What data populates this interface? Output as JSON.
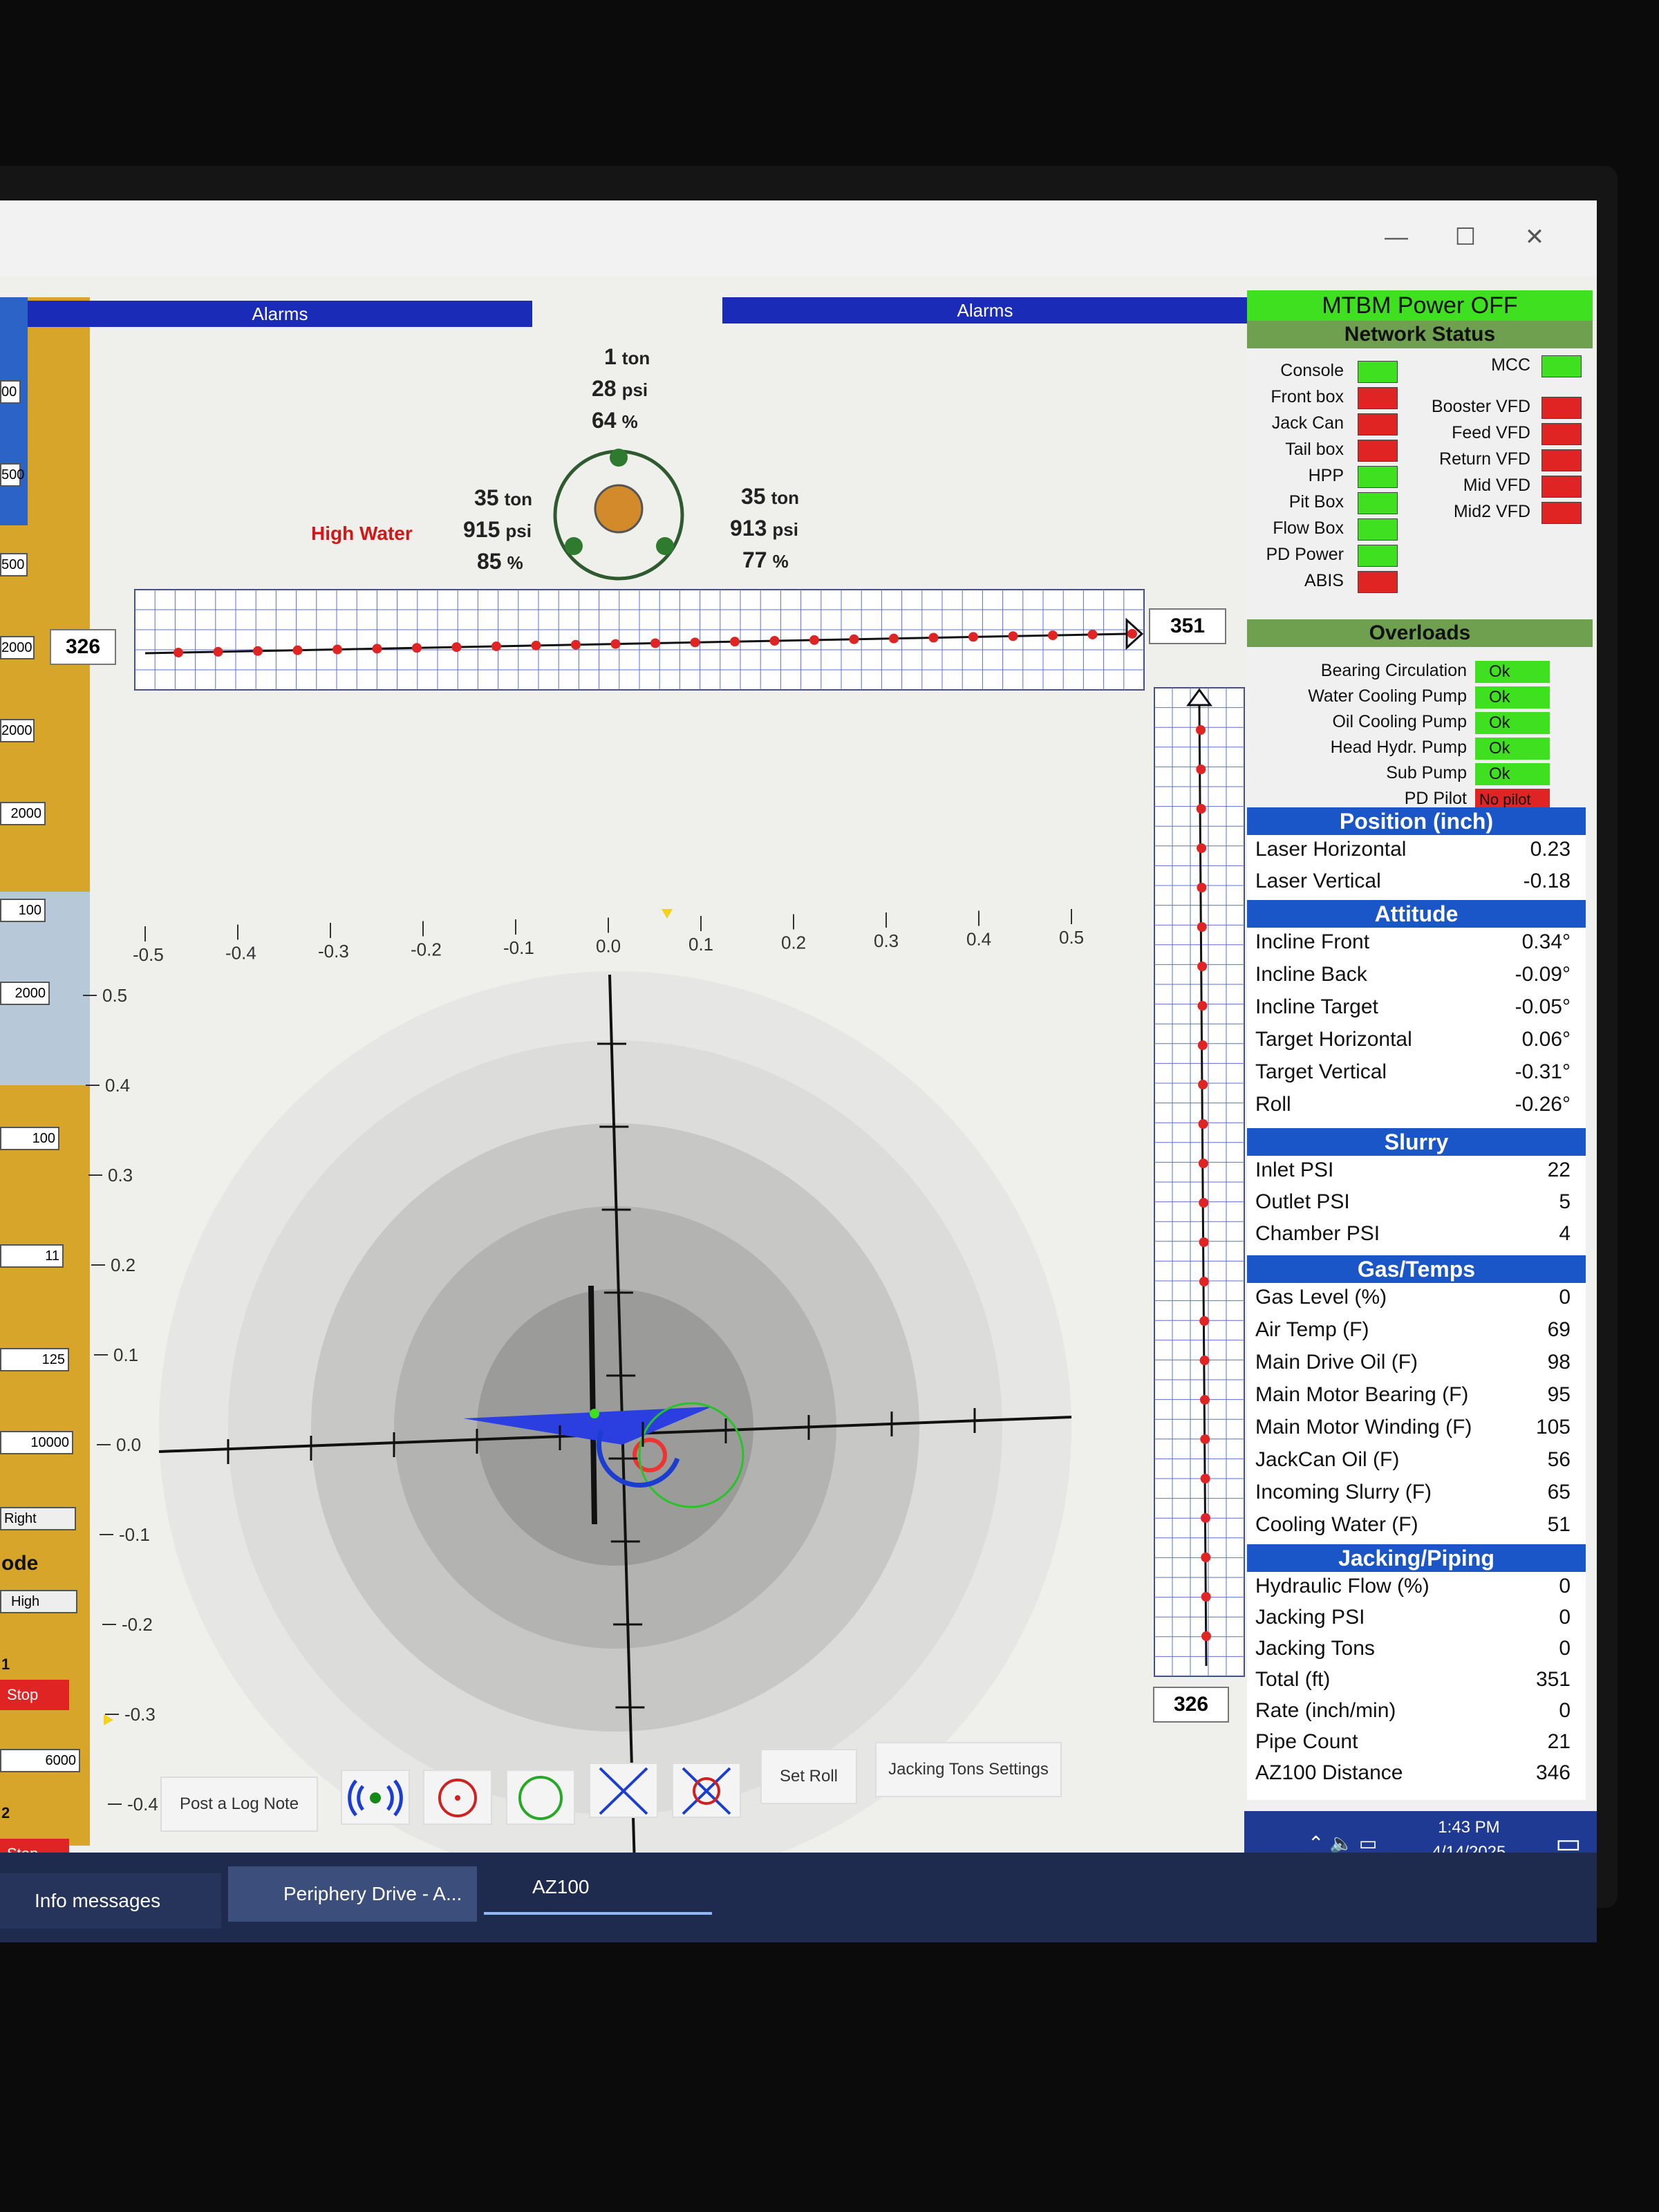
{
  "window": {
    "minimize": "—",
    "maximize": "☐",
    "close": "✕"
  },
  "alarms": {
    "left_label": "Alarms",
    "right_label": "Alarms"
  },
  "left_strip": {
    "values": [
      "00",
      "500",
      "500",
      "2000",
      "2000",
      "2000",
      "100",
      "2000",
      "100",
      "11",
      "125",
      "10000",
      "6000"
    ],
    "right_label": "Right",
    "mode_label": "ode",
    "mode_value": "High",
    "marker1": "1",
    "marker2": "2",
    "stop1": "Stop",
    "stop2": "Stop"
  },
  "gauge": {
    "top": {
      "tons": "1",
      "tons_unit": "ton",
      "psi": "28",
      "psi_unit": "psi",
      "pct": "64",
      "pct_unit": "%"
    },
    "left": {
      "tons": "35",
      "tons_unit": "ton",
      "psi": "915",
      "psi_unit": "psi",
      "pct": "85",
      "pct_unit": "%"
    },
    "right": {
      "tons": "35",
      "tons_unit": "ton",
      "psi": "913",
      "psi_unit": "psi",
      "pct": "77",
      "pct_unit": "%"
    },
    "alert": "High Water"
  },
  "horizontal_bar": {
    "left_value": "326",
    "right_value": "351"
  },
  "vertical_bar": {
    "bottom_value": "326"
  },
  "target": {
    "x_ticks": [
      "-0.5",
      "-0.4",
      "-0.3",
      "-0.2",
      "-0.1",
      "0.0",
      "0.1",
      "0.2",
      "0.3",
      "0.4",
      "0.5"
    ],
    "y_ticks": [
      "0.5",
      "0.4",
      "0.3",
      "0.2",
      "0.1",
      "0.0",
      "-0.1",
      "-0.2",
      "-0.3",
      "-0.4",
      "-0.5"
    ]
  },
  "toolbar": {
    "post_log": "Post a Log Note",
    "set_roll": "Set Roll",
    "jacking_settings": "Jacking Tons Settings"
  },
  "panel": {
    "power": "MTBM Power OFF",
    "network_title": "Network Status",
    "network_left": [
      {
        "label": "Console",
        "status": "green"
      },
      {
        "label": "Front box",
        "status": "red"
      },
      {
        "label": "Jack Can",
        "status": "red"
      },
      {
        "label": "Tail box",
        "status": "red"
      },
      {
        "label": "HPP",
        "status": "green"
      },
      {
        "label": "Pit Box",
        "status": "green"
      },
      {
        "label": "Flow Box",
        "status": "green"
      },
      {
        "label": "PD Power",
        "status": "green"
      },
      {
        "label": "ABIS",
        "status": "red"
      }
    ],
    "network_right": [
      {
        "label": "MCC",
        "status": "green"
      },
      {
        "label": "Booster VFD",
        "status": "red"
      },
      {
        "label": "Feed VFD",
        "status": "red"
      },
      {
        "label": "Return VFD",
        "status": "red"
      },
      {
        "label": "Mid VFD",
        "status": "red"
      },
      {
        "label": "Mid2 VFD",
        "status": "red"
      }
    ],
    "overloads_title": "Overloads",
    "overloads": [
      {
        "label": "Bearing Circulation",
        "value": "Ok",
        "status": "green"
      },
      {
        "label": "Water Cooling Pump",
        "value": "Ok",
        "status": "green"
      },
      {
        "label": "Oil Cooling Pump",
        "value": "Ok",
        "status": "green"
      },
      {
        "label": "Head Hydr. Pump",
        "value": "Ok",
        "status": "green"
      },
      {
        "label": "Sub Pump",
        "value": "Ok",
        "status": "green"
      },
      {
        "label": "PD Pilot",
        "value": "No pilot",
        "status": "red"
      }
    ],
    "position_title": "Position (inch)",
    "position": [
      {
        "label": "Laser Horizontal",
        "value": "0.23"
      },
      {
        "label": "Laser Vertical",
        "value": "-0.18"
      }
    ],
    "attitude_title": "Attitude",
    "attitude": [
      {
        "label": "Incline Front",
        "value": "0.34°"
      },
      {
        "label": "Incline Back",
        "value": "-0.09°"
      },
      {
        "label": "Incline Target",
        "value": "-0.05°"
      },
      {
        "label": "Target Horizontal",
        "value": "0.06°"
      },
      {
        "label": "Target Vertical",
        "value": "-0.31°"
      },
      {
        "label": "Roll",
        "value": "-0.26°"
      }
    ],
    "slurry_title": "Slurry",
    "slurry": [
      {
        "label": "Inlet PSI",
        "value": "22"
      },
      {
        "label": "Outlet PSI",
        "value": "5"
      },
      {
        "label": "Chamber PSI",
        "value": "4"
      }
    ],
    "gas_title": "Gas/Temps",
    "gas": [
      {
        "label": "Gas Level (%)",
        "value": "0"
      },
      {
        "label": "Air Temp (F)",
        "value": "69"
      },
      {
        "label": "Main Drive Oil (F)",
        "value": "98"
      },
      {
        "label": "Main Motor Bearing (F)",
        "value": "95"
      },
      {
        "label": "Main Motor Winding (F)",
        "value": "105"
      },
      {
        "label": "JackCan Oil (F)",
        "value": "56"
      },
      {
        "label": "Incoming Slurry (F)",
        "value": "65"
      },
      {
        "label": "Cooling Water (F)",
        "value": "51"
      }
    ],
    "jacking_title": "Jacking/Piping",
    "jacking": [
      {
        "label": "Hydraulic Flow (%)",
        "value": "0"
      },
      {
        "label": "Jacking PSI",
        "value": "0"
      },
      {
        "label": "Jacking Tons",
        "value": "0"
      },
      {
        "label": "Total (ft)",
        "value": "351"
      },
      {
        "label": "Rate (inch/min)",
        "value": "0"
      },
      {
        "label": "Pipe Count",
        "value": "21"
      },
      {
        "label": "AZ100 Distance",
        "value": "346"
      }
    ]
  },
  "system": {
    "time": "1:43 PM",
    "date": "4/14/2025"
  },
  "taskbar": {
    "item1": "Info messages",
    "item2": "Periphery Drive - A...",
    "item3": "AZ100"
  },
  "colors": {
    "green": "#3fe020",
    "red": "#e02424",
    "blue": "#1b56c8"
  }
}
